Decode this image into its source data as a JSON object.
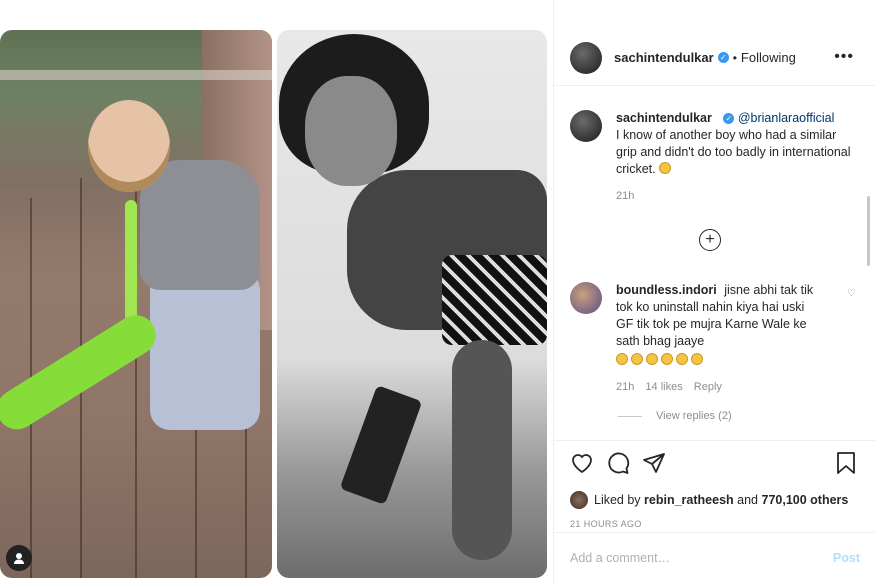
{
  "post": {
    "author": "sachintendulkar",
    "follow_state": "Following",
    "dot": "•",
    "more": "•••"
  },
  "caption": {
    "user": "sachintendulkar",
    "mention": "@brianlaraofficial",
    "text": "I know of another boy who had a similar grip and didn't do too badly in international cricket.",
    "time": "21h"
  },
  "comments": [
    {
      "user": "boundless.indori",
      "text": "jisne abhi tak tik tok ko uninstall nahin kiya hai uski GF tik tok pe mujra Karne Wale ke sath bhag jaaye",
      "time": "21h",
      "likes": "14 likes",
      "reply": "Reply",
      "view_replies": "View replies (2)"
    }
  ],
  "likes": {
    "prefix": "Liked by",
    "user": "rebin_ratheesh",
    "joiner": "and",
    "others": "770,100 others"
  },
  "time_ago": "21 HOURS AGO",
  "add_comment": {
    "placeholder": "Add a comment…",
    "post_label": "Post"
  },
  "colors": {
    "verified": "#3897f0",
    "post_button": "#b2dffc",
    "mention": "#00376b"
  }
}
